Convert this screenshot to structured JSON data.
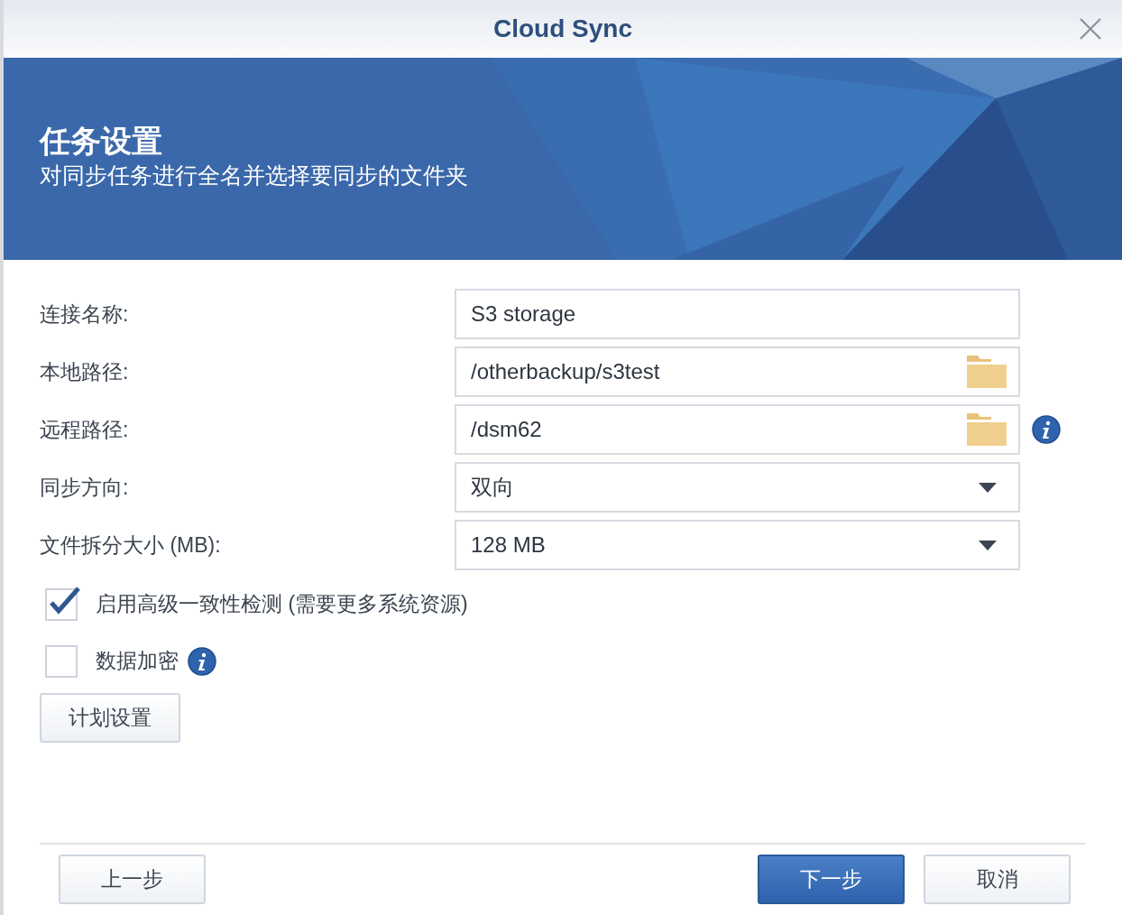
{
  "window": {
    "title": "Cloud Sync"
  },
  "banner": {
    "title": "任务设置",
    "subtitle": "对同步任务进行全名并选择要同步的文件夹"
  },
  "fields": [
    {
      "label": "连接名称:",
      "kind": "text",
      "value": "S3 storage",
      "info": false
    },
    {
      "label": "本地路径:",
      "kind": "folder",
      "value": "/otherbackup/s3test",
      "info": false
    },
    {
      "label": "远程路径:",
      "kind": "folder",
      "value": "/dsm62",
      "info": true
    },
    {
      "label": "同步方向:",
      "kind": "select",
      "value": "双向",
      "info": false
    },
    {
      "label": "文件拆分大小 (MB):",
      "kind": "select",
      "value": "128 MB",
      "info": false
    }
  ],
  "options": [
    {
      "label": "启用高级一致性检测 (需要更多系统资源)",
      "checked": true,
      "info": false
    },
    {
      "label": "数据加密",
      "checked": false,
      "info": true
    }
  ],
  "schedule_button": "计划设置",
  "footer": {
    "back": "上一步",
    "next": "下一步",
    "cancel": "取消"
  }
}
